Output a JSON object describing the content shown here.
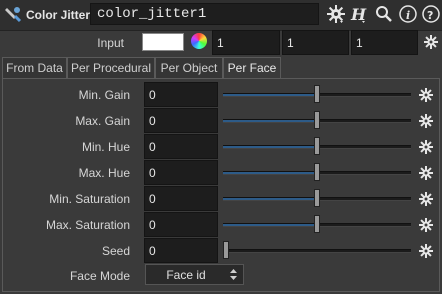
{
  "header": {
    "node_type": "Color Jitter",
    "node_name": "color_jitter1"
  },
  "input_row": {
    "label": "Input",
    "swatch_color": "#ffffff",
    "values": [
      "1",
      "1",
      "1"
    ]
  },
  "tabs": [
    {
      "label": "From Data",
      "active": false
    },
    {
      "label": "Per Procedural",
      "active": false
    },
    {
      "label": "Per Object",
      "active": false
    },
    {
      "label": "Per Face",
      "active": true
    }
  ],
  "params": [
    {
      "label": "Min. Gain",
      "value": "0",
      "slider_fraction": 0.5
    },
    {
      "label": "Max. Gain",
      "value": "0",
      "slider_fraction": 0.5
    },
    {
      "label": "Min. Hue",
      "value": "0",
      "slider_fraction": 0.5
    },
    {
      "label": "Max. Hue",
      "value": "0",
      "slider_fraction": 0.5
    },
    {
      "label": "Min. Saturation",
      "value": "0",
      "slider_fraction": 0.5
    },
    {
      "label": "Max. Saturation",
      "value": "0",
      "slider_fraction": 0.5
    },
    {
      "label": "Seed",
      "value": "0",
      "slider_fraction": 0.0
    }
  ],
  "face_mode": {
    "label": "Face Mode",
    "value": "Face id"
  },
  "colors": {
    "slider_fill": "#2d5b88",
    "panel_bg": "#3a3a3a"
  },
  "icons": [
    "node-icon",
    "gear-icon",
    "help-h-icon",
    "search-icon",
    "info-icon",
    "help-icon",
    "color-wheel-icon",
    "select-arrows-icon"
  ]
}
